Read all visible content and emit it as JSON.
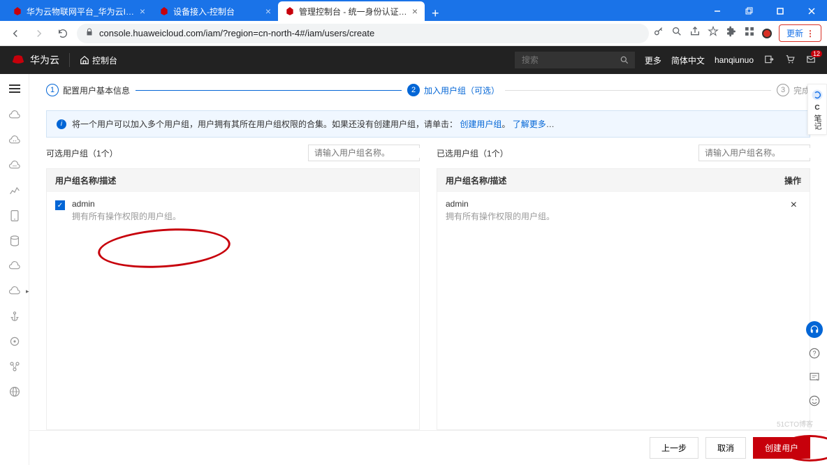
{
  "browser": {
    "tabs": [
      {
        "title": "华为云物联网平台_华为云IoT平台",
        "active": false
      },
      {
        "title": "设备接入-控制台",
        "active": false
      },
      {
        "title": "管理控制台 - 统一身份认证服务",
        "active": true
      }
    ],
    "url": "console.huaweicloud.com/iam/?region=cn-north-4#/iam/users/create",
    "update_label": "更新"
  },
  "header": {
    "brand": "华为云",
    "console": "控制台",
    "search_placeholder": "搜索",
    "more": "更多",
    "lang": "简体中文",
    "user": "hanqiunuo",
    "badge": "12"
  },
  "stepper": {
    "step1": "配置用户基本信息",
    "step2": "加入用户组（可选）",
    "step3": "完成"
  },
  "banner": {
    "text": "将一个用户可以加入多个用户组，用户拥有其所在用户组权限的合集。如果还没有创建用户组，请单击：",
    "link1": "创建用户组",
    "sep": "。",
    "link2": "了解更多",
    "ellipsis": "…"
  },
  "left_panel": {
    "title": "可选用户组（1个）",
    "search_placeholder": "请输入用户组名称。",
    "col_header": "用户组名称/描述",
    "item_name": "admin",
    "item_desc": "拥有所有操作权限的用户组。"
  },
  "right_panel": {
    "title": "已选用户组（1个）",
    "search_placeholder": "请输入用户组名称。",
    "col_header": "用户组名称/描述",
    "col_action": "操作",
    "item_name": "admin",
    "item_desc": "拥有所有操作权限的用户组。"
  },
  "footer": {
    "prev": "上一步",
    "cancel": "取消",
    "create": "创建用户"
  },
  "float": {
    "note_c": "C",
    "note_label": "笔记"
  }
}
